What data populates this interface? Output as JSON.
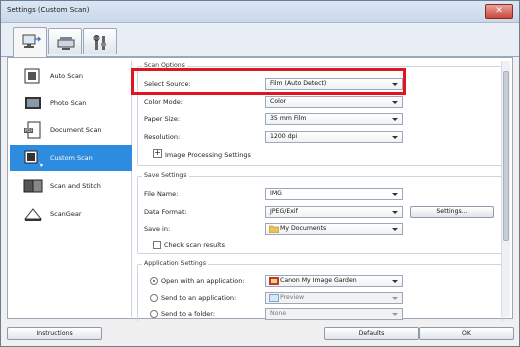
{
  "window": {
    "title": "Settings (Custom Scan)"
  },
  "sidebar": {
    "items": [
      {
        "label": "Auto Scan"
      },
      {
        "label": "Photo Scan"
      },
      {
        "label": "Document Scan"
      },
      {
        "label": "Custom Scan"
      },
      {
        "label": "Scan and Stitch"
      },
      {
        "label": "ScanGear"
      }
    ]
  },
  "scan_options": {
    "title": "Scan Options",
    "select_source": {
      "label": "Select Source:",
      "value": "Film (Auto Detect)"
    },
    "color_mode": {
      "label": "Color Mode:",
      "value": "Color"
    },
    "paper_size": {
      "label": "Paper Size:",
      "value": "35 mm Film"
    },
    "resolution": {
      "label": "Resolution:",
      "value": "1200 dpi"
    },
    "image_processing": {
      "label": "Image Processing Settings"
    }
  },
  "save_settings": {
    "title": "Save Settings",
    "file_name": {
      "label": "File Name:",
      "value": "IMG"
    },
    "data_format": {
      "label": "Data Format:",
      "value": "JPEG/Exif",
      "settings_button": "Settings..."
    },
    "save_in": {
      "label": "Save in:",
      "value": "My Documents"
    },
    "check_scan_results": {
      "label": "Check scan results"
    }
  },
  "application_settings": {
    "title": "Application Settings",
    "open_with": {
      "label": "Open with an application:",
      "value": "Canon My Image Garden"
    },
    "send_to_app": {
      "label": "Send to an application:",
      "value": "Preview"
    },
    "send_to_folder": {
      "label": "Send to a folder:",
      "value": "None"
    }
  },
  "footer": {
    "instructions": "Instructions",
    "defaults": "Defaults",
    "ok": "OK"
  },
  "colors": {
    "highlight_box": "#e0151f",
    "selected_item": "#2d8ce0"
  }
}
